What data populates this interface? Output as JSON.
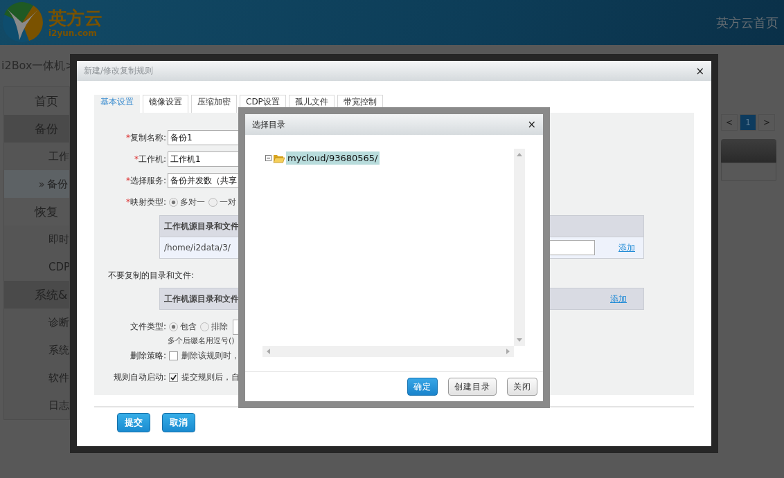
{
  "header": {
    "logo_text": "英方云",
    "logo_subtext": "i2yun.com",
    "home_link": "英方云首页"
  },
  "breadcrumb": "i2Box一体机>",
  "sidebar": {
    "items": [
      {
        "label": "首页",
        "kind": "top",
        "selected": false
      },
      {
        "label": "备份",
        "kind": "section",
        "selected": false
      },
      {
        "label": "工作",
        "kind": "sub",
        "selected": false
      },
      {
        "label": "备份",
        "kind": "sub",
        "selected": true
      },
      {
        "label": "恢复",
        "kind": "top",
        "selected": false
      },
      {
        "label": "即时",
        "kind": "sub",
        "selected": false
      },
      {
        "label": "CDP",
        "kind": "sub",
        "selected": false
      },
      {
        "label": "系统&",
        "kind": "section",
        "selected": false
      },
      {
        "label": "诊断",
        "kind": "sub",
        "selected": false
      },
      {
        "label": "系统",
        "kind": "sub",
        "selected": false
      },
      {
        "label": "软件",
        "kind": "sub",
        "selected": false
      },
      {
        "label": "日志",
        "kind": "sub",
        "selected": false
      }
    ]
  },
  "pagination": {
    "prev": "<",
    "next": ">",
    "pages": [
      {
        "label": "1",
        "selected": true
      }
    ]
  },
  "modal": {
    "title": "新建/修改复制规则",
    "close": "×",
    "tabs": [
      {
        "label": "基本设置",
        "selected": true
      },
      {
        "label": "镜像设置",
        "selected": false
      },
      {
        "label": "压缩加密",
        "selected": false
      },
      {
        "label": "CDP设置",
        "selected": false
      },
      {
        "label": "孤儿文件",
        "selected": false
      },
      {
        "label": "带宽控制",
        "selected": false
      }
    ],
    "form": [
      {
        "kind": "input",
        "mark": "*",
        "label": "复制名称:",
        "value": "备份1"
      },
      {
        "kind": "input",
        "mark": "*",
        "label": "工作机:",
        "value": "工作机1"
      },
      {
        "kind": "input",
        "mark": "*",
        "label": "选择服务:",
        "value": "备份并发数（共享"
      },
      {
        "kind": "radio",
        "mark": "*",
        "label": "映射类型:",
        "options": [
          {
            "label": "多对一",
            "selected": true
          },
          {
            "label": "一对",
            "selected": false
          }
        ]
      },
      {
        "kind": "table",
        "header": "工作机源目录和文件",
        "link": "添加",
        "row": "/home/i2data/3/"
      },
      {
        "kind": "note",
        "label": "不要复制的目录和文件:"
      },
      {
        "kind": "table",
        "header": "工作机源目录和文件",
        "link": "添加"
      },
      {
        "kind": "radio",
        "label": "文件类型:",
        "options": [
          {
            "label": "包含",
            "selected": true
          },
          {
            "label": "排除",
            "selected": false
          }
        ],
        "field": true,
        "hint": "多个后缀名用逗号()"
      },
      {
        "kind": "checkbox",
        "label": "删除策略:",
        "checked": false,
        "text": "删除该规则时，"
      },
      {
        "kind": "checkbox",
        "label": "规则自动启动:",
        "checked": true,
        "text": "提交规则后，自"
      }
    ],
    "buttons": [
      "提交",
      "取消"
    ]
  },
  "dialog": {
    "title": "选择目录",
    "close": "×",
    "tree": [
      {
        "label": "mycloud/93680565/",
        "expanded": true,
        "selected": true
      }
    ],
    "buttons": [
      {
        "label": "确定",
        "primary": true
      },
      {
        "label": "创建目录",
        "primary": false
      },
      {
        "label": "关闭",
        "primary": false
      }
    ]
  }
}
